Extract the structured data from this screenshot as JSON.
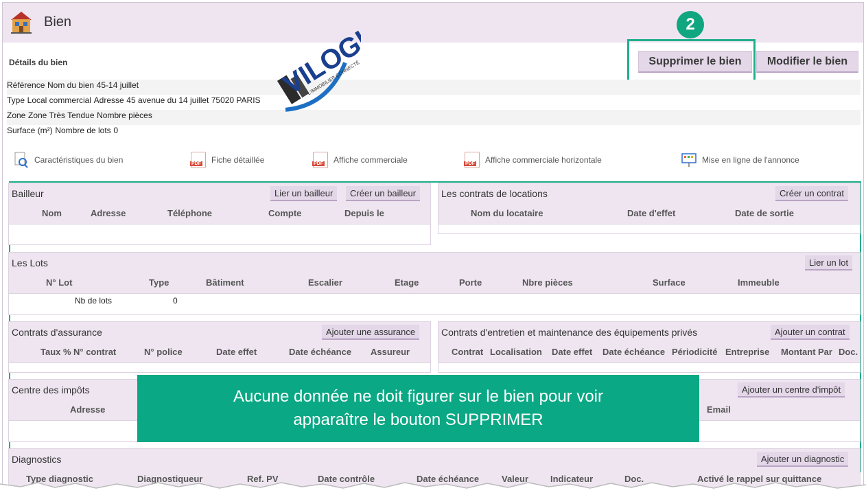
{
  "header": {
    "title": "Bien"
  },
  "details_label": "Détails du bien",
  "actions": {
    "delete": "Supprimer le bien",
    "edit": "Modifier le bien",
    "step": "2"
  },
  "details": {
    "left": [
      {
        "label": "Référence",
        "value": ""
      },
      {
        "label": "Type",
        "value": "Local commercial"
      },
      {
        "label": "Zone",
        "value": "Zone Très Tendue"
      },
      {
        "label": "Surface (m²)",
        "value": ""
      }
    ],
    "right": [
      {
        "label": "Nom du bien",
        "value": "45-14 juillet"
      },
      {
        "label": "Adresse",
        "value": "45 avenue du 14 juillet 75020 PARIS"
      },
      {
        "label": "Nombre pièces",
        "value": ""
      },
      {
        "label": "Nombre de lots",
        "value": "0"
      }
    ]
  },
  "links": [
    "Caractéristiques du bien",
    "Fiche détaillée",
    "Affiche commerciale",
    "Affiche commerciale horizontale",
    "Mise en ligne de l'annonce"
  ],
  "bailleur": {
    "title": "Bailleur",
    "btn1": "Lier un bailleur",
    "btn2": "Créer un bailleur",
    "cols": [
      "Nom",
      "Adresse",
      "Téléphone",
      "Compte",
      "Depuis le"
    ]
  },
  "contrats_locations": {
    "title": "Les contrats de locations",
    "btn": "Créer un contrat",
    "cols": [
      "Nom du locataire",
      "Date d'effet",
      "Date de sortie"
    ]
  },
  "lots": {
    "title": "Les Lots",
    "btn": "Lier un lot",
    "cols": [
      "N° Lot",
      "Type",
      "Bâtiment",
      "Escalier",
      "Etage",
      "Porte",
      "Nbre pièces",
      "Surface",
      "Immeuble"
    ],
    "count_label": "Nb de lots",
    "count_value": "0"
  },
  "assurance": {
    "title": "Contrats d'assurance",
    "btn": "Ajouter une assurance",
    "cols": [
      "Taux %",
      "N° contrat",
      "N° police",
      "Date effet",
      "Date échéance",
      "Assureur"
    ]
  },
  "entretien": {
    "title": "Contrats d'entretien et maintenance des équipements privés",
    "btn": "Ajouter un contrat",
    "cols": [
      "Contrat",
      "Localisation",
      "Date effet",
      "Date échéance",
      "Périodicité",
      "Entreprise",
      "Montant",
      "Par",
      "Doc."
    ]
  },
  "impots": {
    "title": "Centre des impôts",
    "btn": "Ajouter un centre d'impôt",
    "cols": [
      "Adresse",
      "Email"
    ]
  },
  "diagnostics": {
    "title": "Diagnostics",
    "btn": "Ajouter un diagnostic",
    "cols": [
      "Type diagnostic",
      "Diagnostiqueur",
      "Ref. PV",
      "Date contrôle",
      "Date échéance",
      "Valeur",
      "Indicateur",
      "Doc.",
      "Activé le rappel sur quittance"
    ]
  },
  "overlay": {
    "line1": "Aucune donnée ne doit figurer sur le bien pour voir",
    "line2": "apparaître le bouton SUPPRIMER"
  },
  "logo": {
    "brand": "VILOGI",
    "tagline": "L'IMMOBILIER CONNECTÉ"
  },
  "colors": {
    "accent": "#1fae8c",
    "panel_bg": "#eee5f0",
    "button_bg": "#e3d7e8",
    "overlay_bg": "#0aa884"
  }
}
